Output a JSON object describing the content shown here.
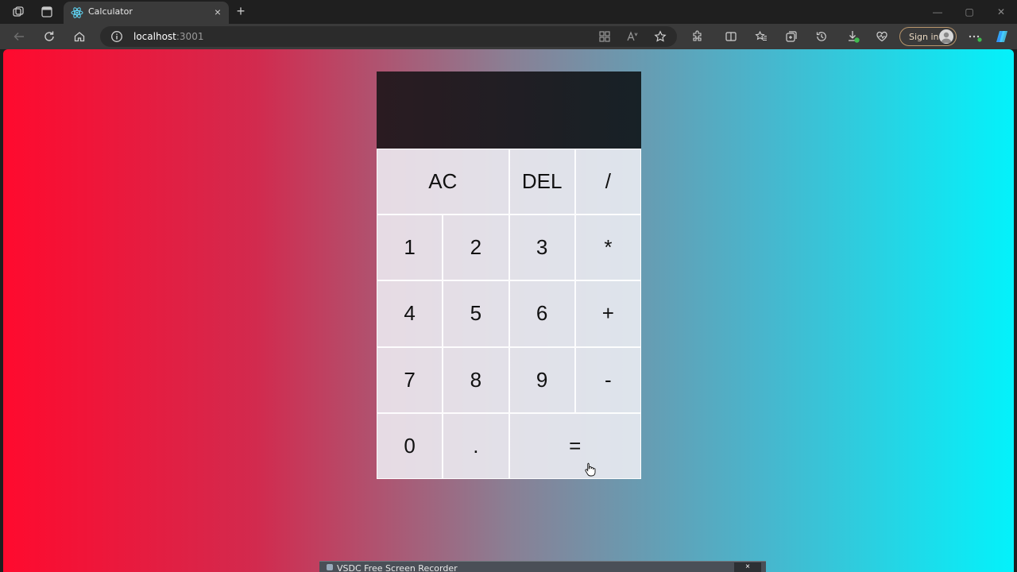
{
  "browser": {
    "tab": {
      "title": "Calculator",
      "favicon": "react-icon",
      "close": "×"
    },
    "new_tab": "+",
    "address": {
      "host": "localhost",
      "port": ":3001"
    },
    "sign_in": "Sign in",
    "window_controls": {
      "minimize": "—",
      "maximize": "▢",
      "close": "✕"
    }
  },
  "calculator": {
    "display": {
      "previous": "",
      "current": ""
    },
    "keys": [
      {
        "label": "AC",
        "name": "key-ac",
        "wide": true
      },
      {
        "label": "DEL",
        "name": "key-del",
        "wide": false
      },
      {
        "label": "/",
        "name": "key-divide",
        "wide": false
      },
      {
        "label": "1",
        "name": "key-1",
        "wide": false
      },
      {
        "label": "2",
        "name": "key-2",
        "wide": false
      },
      {
        "label": "3",
        "name": "key-3",
        "wide": false
      },
      {
        "label": "*",
        "name": "key-multiply",
        "wide": false
      },
      {
        "label": "4",
        "name": "key-4",
        "wide": false
      },
      {
        "label": "5",
        "name": "key-5",
        "wide": false
      },
      {
        "label": "6",
        "name": "key-6",
        "wide": false
      },
      {
        "label": "+",
        "name": "key-plus",
        "wide": false
      },
      {
        "label": "7",
        "name": "key-7",
        "wide": false
      },
      {
        "label": "8",
        "name": "key-8",
        "wide": false
      },
      {
        "label": "9",
        "name": "key-9",
        "wide": false
      },
      {
        "label": "-",
        "name": "key-minus",
        "wide": false
      },
      {
        "label": "0",
        "name": "key-0",
        "wide": false
      },
      {
        "label": ".",
        "name": "key-decimal",
        "wide": false
      },
      {
        "label": "=",
        "name": "key-equals",
        "wide": true
      }
    ]
  },
  "recorder": {
    "title": "VSDC Free Screen Recorder",
    "close": "×"
  },
  "colors": {
    "gradient_left": "#ff0a2e",
    "gradient_right": "#03f2fb",
    "display_bg": "#1f1d22",
    "key_bg": "#e8e6ec"
  }
}
